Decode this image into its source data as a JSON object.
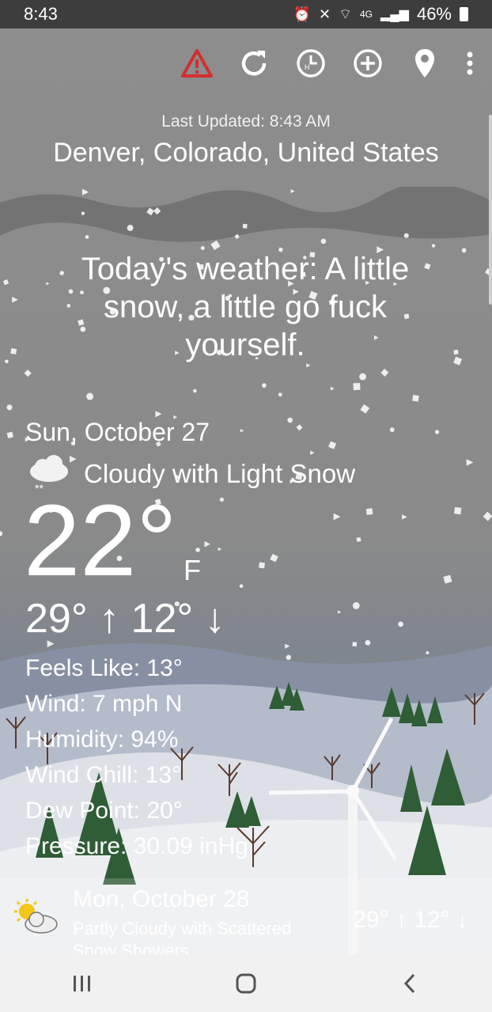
{
  "status": {
    "time": "8:43",
    "network": "4G",
    "battery": "46%"
  },
  "toolbar": {
    "icons": [
      "alert-icon",
      "refresh-icon",
      "history-icon",
      "add-icon",
      "location-icon",
      "more-icon"
    ]
  },
  "header": {
    "last_updated": "Last Updated: 8:43 AM",
    "location": "Denver, Colorado, United States"
  },
  "tagline": "Today's weather: A little snow, a little go fuck yourself.",
  "today": {
    "date": "Sun, October 27",
    "condition": "Cloudy with Light Snow",
    "temperature": "22°",
    "unit": "F",
    "hilo": "29° ↑ 12° ↓",
    "details": [
      "Feels Like: 13°",
      "Wind: 7 mph N",
      "Humidity: 94%",
      "Wind Chill: 13°",
      "Dew Point: 20°",
      "Pressure: 30.09 inHg"
    ]
  },
  "forecast": {
    "date": "Mon, October 28",
    "condition": "Partly Cloudy with Scattered Snow Showers",
    "hilo": "29° ↑ 12° ↓"
  },
  "colors": {
    "alert": "#d32f2f",
    "status_bar": "#3d3d3d",
    "nav_bar": "#f1f1f1",
    "tree": "#2f5d35"
  }
}
